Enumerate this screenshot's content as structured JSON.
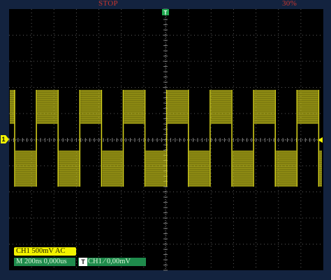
{
  "top_bar": {
    "run_state": "STOP",
    "memory_depth": "30%"
  },
  "trigger_position_marker": {
    "label": "T"
  },
  "channel_marker": {
    "label": "1"
  },
  "status": {
    "channel": "CH1  500mV  AC",
    "timebase": "M  200ns  0,000us",
    "trigger_mode_label": "T",
    "trigger": "CH1  ⁄  0,00mV"
  },
  "colors": {
    "background": "#13233f",
    "screen": "#000000",
    "grid": "#5a5a5a",
    "trace": "#d9d51c",
    "accent_red": "#c8362e",
    "trigger_green": "#1f8b4c"
  },
  "chart_data": {
    "type": "line",
    "title": "",
    "xlabel": "",
    "ylabel": "",
    "series": [
      {
        "name": "CH1",
        "waveform": "square",
        "amplitude_divisions": 1.4,
        "periods_on_screen": 7
      }
    ],
    "x_divisions": 14,
    "y_divisions": 10,
    "grid": true
  }
}
